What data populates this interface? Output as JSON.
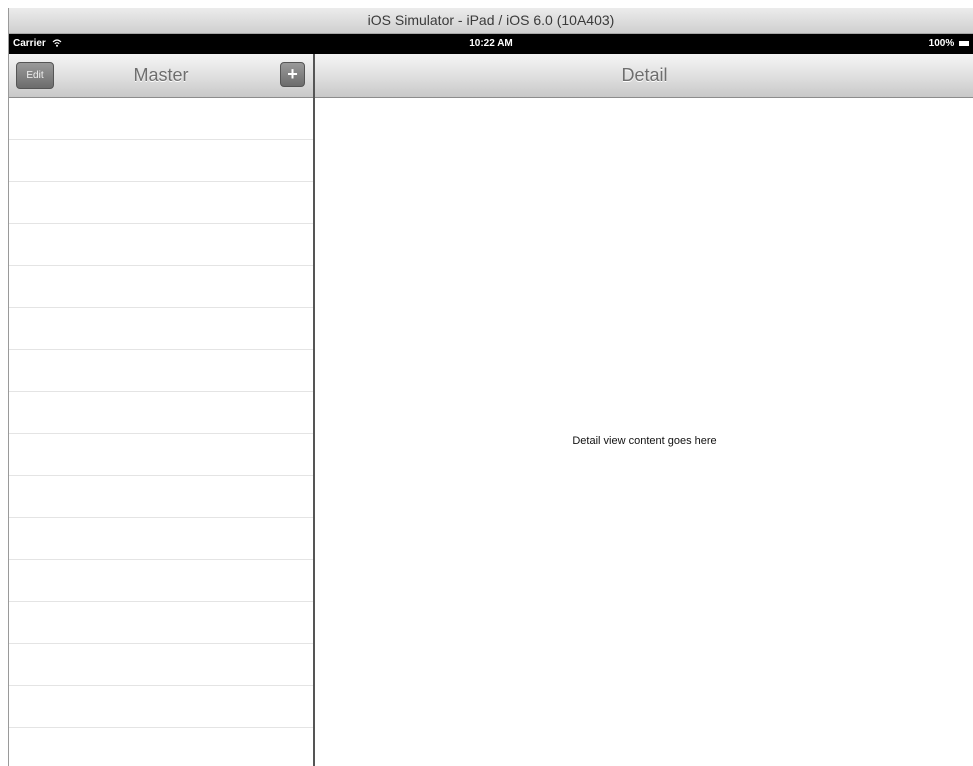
{
  "window": {
    "title": "iOS Simulator - iPad / iOS 6.0 (10A403)"
  },
  "status_bar": {
    "carrier": "Carrier",
    "time": "10:22 AM",
    "battery": "100%",
    "icons": [
      "wifi-icon",
      "battery-icon"
    ]
  },
  "master": {
    "title": "Master",
    "edit_label": "Edit",
    "add_label": "+",
    "rows": [
      "",
      "",
      "",
      "",
      "",
      "",
      "",
      "",
      "",
      "",
      "",
      "",
      "",
      "",
      "",
      ""
    ]
  },
  "detail": {
    "title": "Detail",
    "content": "Detail view content goes here"
  }
}
